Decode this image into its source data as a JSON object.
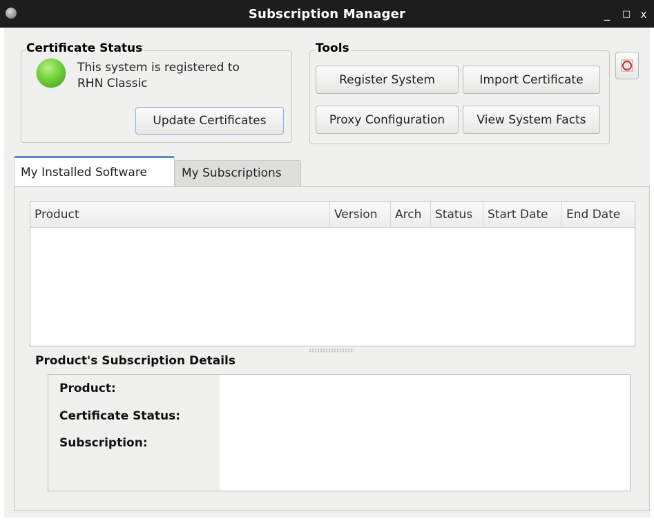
{
  "window": {
    "title": "Subscription Manager",
    "minimize_glyph": "_",
    "maximize_glyph": "□",
    "close_glyph": "x"
  },
  "certificate_status": {
    "legend": "Certificate Status",
    "status_text_line1": "This system is registered to",
    "status_text_line2": "RHN Classic",
    "status_light_color": "#6fd23a",
    "update_button": "Update Certificates"
  },
  "tools": {
    "legend": "Tools",
    "register_button": "Register System",
    "import_button": "Import Certificate",
    "proxy_button": "Proxy Configuration",
    "facts_button": "View System Facts"
  },
  "help_icon": "lifebuoy-icon",
  "tabs": [
    {
      "label": "My Installed Software",
      "active": true
    },
    {
      "label": "My Subscriptions",
      "active": false
    }
  ],
  "table": {
    "columns": [
      "Product",
      "Version",
      "Arch",
      "Status",
      "Start Date",
      "End Date"
    ],
    "rows": []
  },
  "details": {
    "title": "Product's Subscription Details",
    "product_label": "Product:",
    "certificate_status_label": "Certificate Status:",
    "subscription_label": "Subscription:"
  }
}
